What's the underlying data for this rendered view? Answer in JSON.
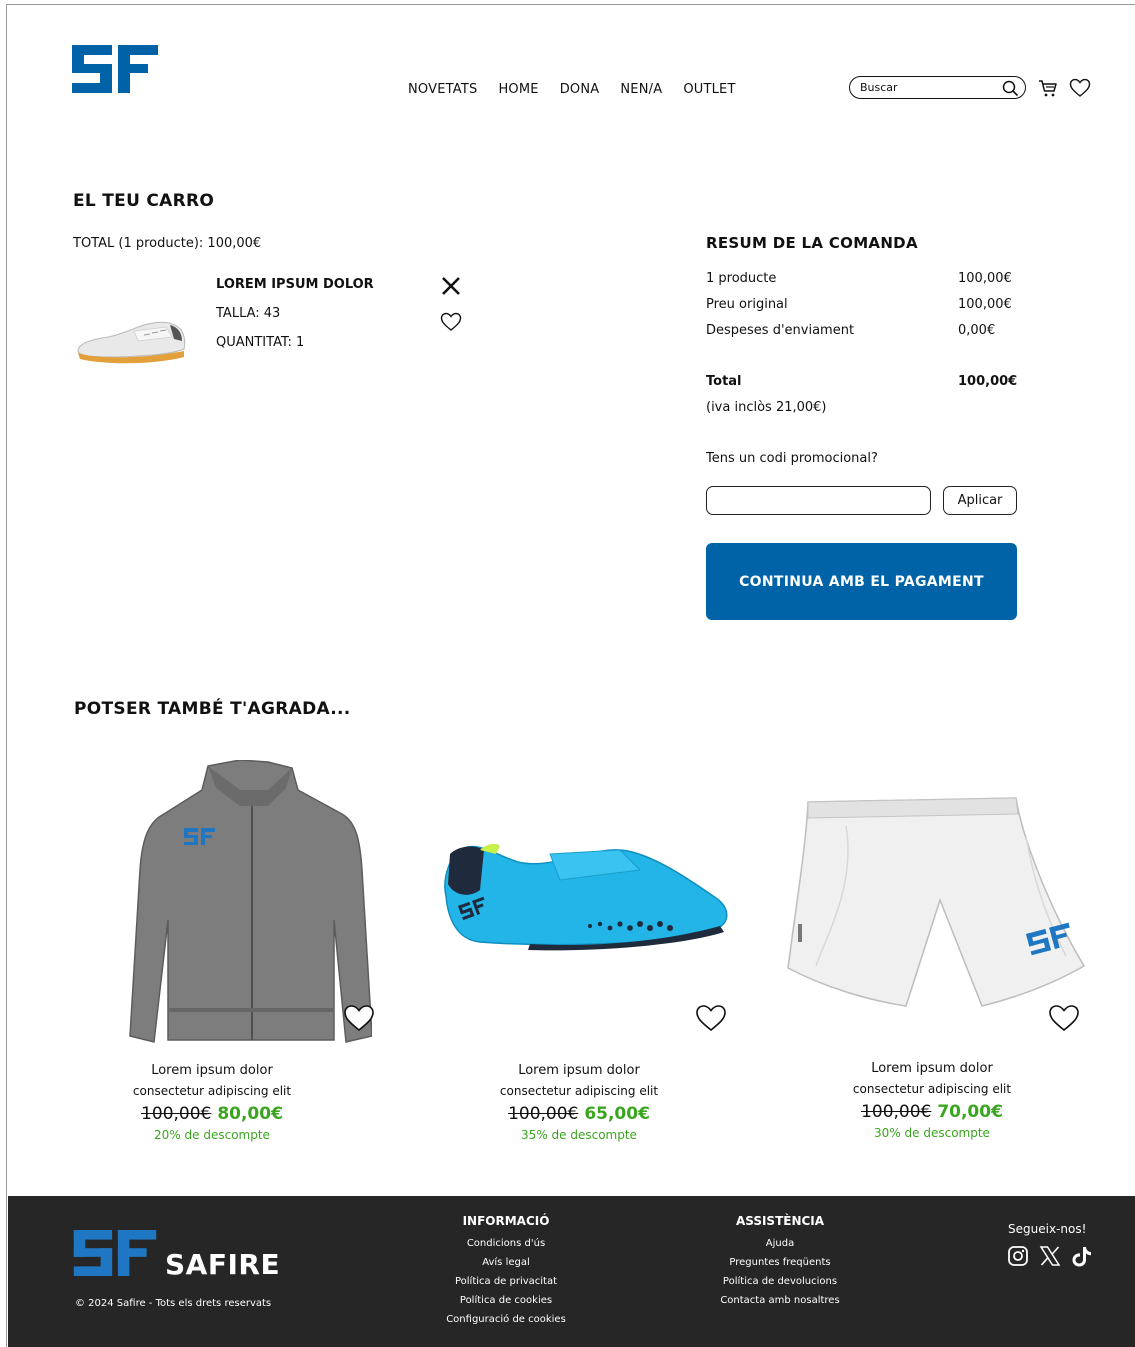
{
  "brand": {
    "name": "SAFIRE",
    "color": "#0063a8"
  },
  "nav": {
    "items": [
      "NOVETATS",
      "HOME",
      "DONA",
      "NEN/A",
      "OUTLET"
    ]
  },
  "search": {
    "placeholder": "Buscar",
    "icon": "search-icon"
  },
  "header_icons": [
    "cart-icon",
    "heart-icon"
  ],
  "cart": {
    "title": "EL TEU CARRO",
    "total_line": "TOTAL (1 producte): 100,00€",
    "item": {
      "name": "LOREM IPSUM DOLOR",
      "size": "TALLA: 43",
      "quantity": "QUANTITAT: 1"
    }
  },
  "summary": {
    "title": "RESUM DE LA COMANDA",
    "rows": [
      {
        "label": "1 producte",
        "value": "100,00€"
      },
      {
        "label": "Preu original",
        "value": "100,00€"
      },
      {
        "label": "Despeses d'enviament",
        "value": "0,00€"
      }
    ],
    "total_label": "Total",
    "total_value": "100,00€",
    "iva": "(iva inclòs 21,00€)",
    "promo_question": "Tens un codi promocional?",
    "promo_value": "",
    "apply_label": "Aplicar",
    "pay_label": "CONTINUA AMB EL PAGAMENT"
  },
  "recommendations": {
    "title": "POTSER TAMBÉ T'AGRADA...",
    "cards": [
      {
        "name": "Lorem ipsum dolor",
        "desc": "consectetur adipiscing elit",
        "old_price": "100,00€",
        "new_price": "80,00€",
        "discount": "20% de descompte"
      },
      {
        "name": "Lorem ipsum dolor",
        "desc": "consectetur adipiscing elit",
        "old_price": "100,00€",
        "new_price": "65,00€",
        "discount": "35% de descompte"
      },
      {
        "name": "Lorem ipsum dolor",
        "desc": "consectetur adipiscing elit",
        "old_price": "100,00€",
        "new_price": "70,00€",
        "discount": "30% de descompte"
      }
    ]
  },
  "footer": {
    "copyright": "© 2024 Safire - Tots els drets reservats",
    "info": {
      "title": "INFORMACIÓ",
      "links": [
        "Condicions d'ús",
        "Avís legal",
        "Política de privacitat",
        "Política de cookies",
        "Configuració de cookies"
      ]
    },
    "help": {
      "title": "ASSISTÈNCIA",
      "links": [
        "Ajuda",
        "Preguntes freqüents",
        "Política de devolucions",
        "Contacta amb nosaltres"
      ]
    },
    "follow": "Segueix-nos!",
    "social": [
      "instagram-icon",
      "x-icon",
      "tiktok-icon"
    ]
  }
}
